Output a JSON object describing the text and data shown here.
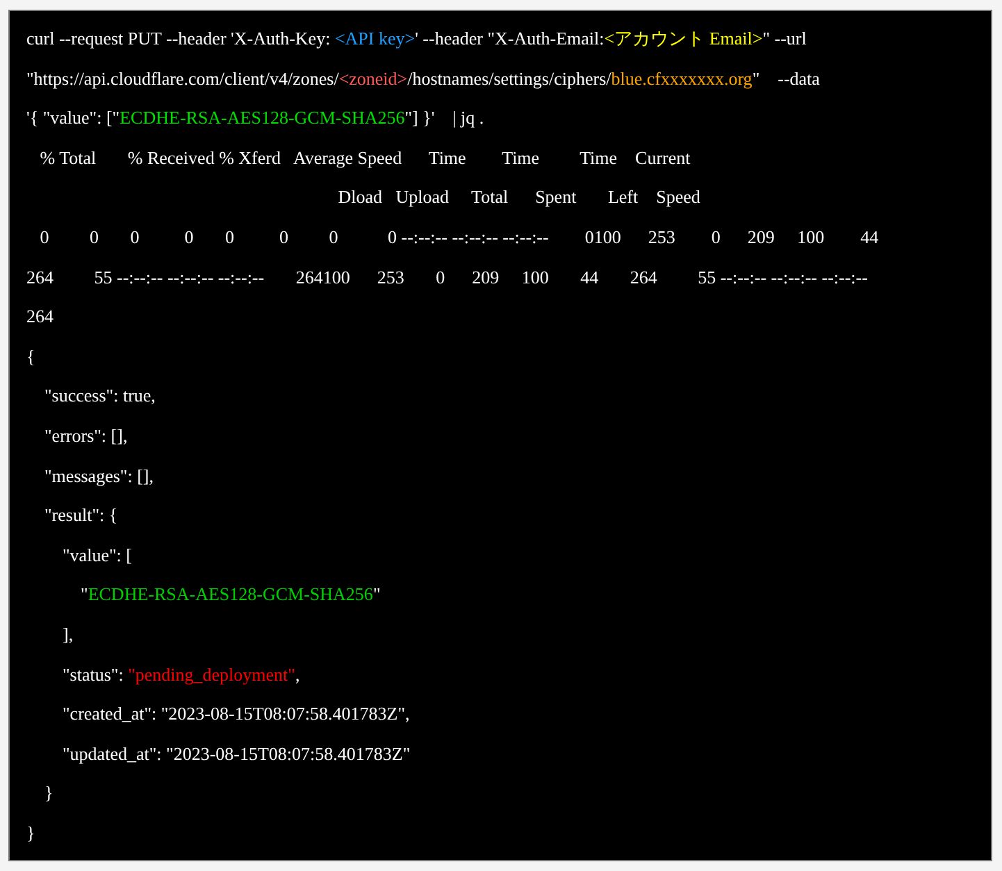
{
  "lines": [
    {
      "segments": [
        {
          "text": "curl --request PUT --header 'X-Auth-Key: "
        },
        {
          "text": "<API key>",
          "color": "#1ea0ff"
        },
        {
          "text": "' --header \"X-Auth-Email:"
        },
        {
          "text": "<アカウント Email>",
          "color": "#ffff00"
        },
        {
          "text": "\" --url"
        }
      ]
    },
    {
      "segments": [
        {
          "text": "\"https://api.cloudflare.com/client/v4/zones/"
        },
        {
          "text": "<zoneid>",
          "color": "#ff5a5a"
        },
        {
          "text": "/hostnames/settings/ciphers/"
        },
        {
          "text": "blue.cfxxxxxxx.org",
          "color": "#ffa500"
        },
        {
          "text": "\"    --data"
        }
      ]
    },
    {
      "segments": [
        {
          "text": "'{ \"value\": [\""
        },
        {
          "text": "ECDHE-RSA-AES128-GCM-SHA256",
          "color": "#00e000"
        },
        {
          "text": "\"] }'    | jq ."
        }
      ]
    },
    {
      "segments": [
        {
          "text": "   % Total       % Received % Xferd   Average Speed      Time        Time         Time    Current"
        }
      ]
    },
    {
      "segments": [
        {
          "text": "                                                                     Dload   Upload     Total      Spent       Left    Speed"
        }
      ]
    },
    {
      "segments": [
        {
          "text": "   0         0       0          0       0          0         0           0 --:--:-- --:--:-- --:--:--        0100      253        0      209     100        44"
        }
      ]
    },
    {
      "segments": [
        {
          "text": "264         55 --:--:-- --:--:-- --:--:--       264100      253       0      209     100       44       264         55 --:--:-- --:--:-- --:--:--"
        }
      ]
    },
    {
      "segments": [
        {
          "text": "264"
        }
      ]
    },
    {
      "segments": [
        {
          "text": "{"
        }
      ],
      "children": [
        {
          "segments": [
            {
              "text": "\"success\": true,"
            }
          ]
        },
        {
          "segments": [
            {
              "text": "\"errors\": [],"
            }
          ]
        },
        {
          "segments": [
            {
              "text": "\"messages\": [],"
            }
          ]
        },
        {
          "segments": [
            {
              "text": "\"result\": {"
            }
          ],
          "children": [
            {
              "segments": [
                {
                  "text": "\"value\": ["
                }
              ],
              "children": [
                {
                  "segments": [
                    {
                      "text": "\""
                    },
                    {
                      "text": "ECDHE-RSA-AES128-GCM-SHA256",
                      "color": "#00d000"
                    },
                    {
                      "text": "\""
                    }
                  ]
                }
              ]
            },
            {
              "segments": [
                {
                  "text": "],"
                }
              ]
            },
            {
              "segments": [
                {
                  "text": "\"status\": "
                },
                {
                  "text": "\"pending_deployment\"",
                  "color": "#ff0000"
                },
                {
                  "text": ","
                }
              ]
            },
            {
              "segments": [
                {
                  "text": "\"created_at\": \"2023-08-15T08:07:58.401783Z\","
                }
              ]
            },
            {
              "segments": [
                {
                  "text": "\"updated_at\": \"2023-08-15T08:07:58.401783Z\""
                }
              ]
            }
          ]
        },
        {
          "segments": [
            {
              "text": "}"
            }
          ]
        }
      ]
    },
    {
      "segments": [
        {
          "text": "}"
        }
      ]
    }
  ]
}
